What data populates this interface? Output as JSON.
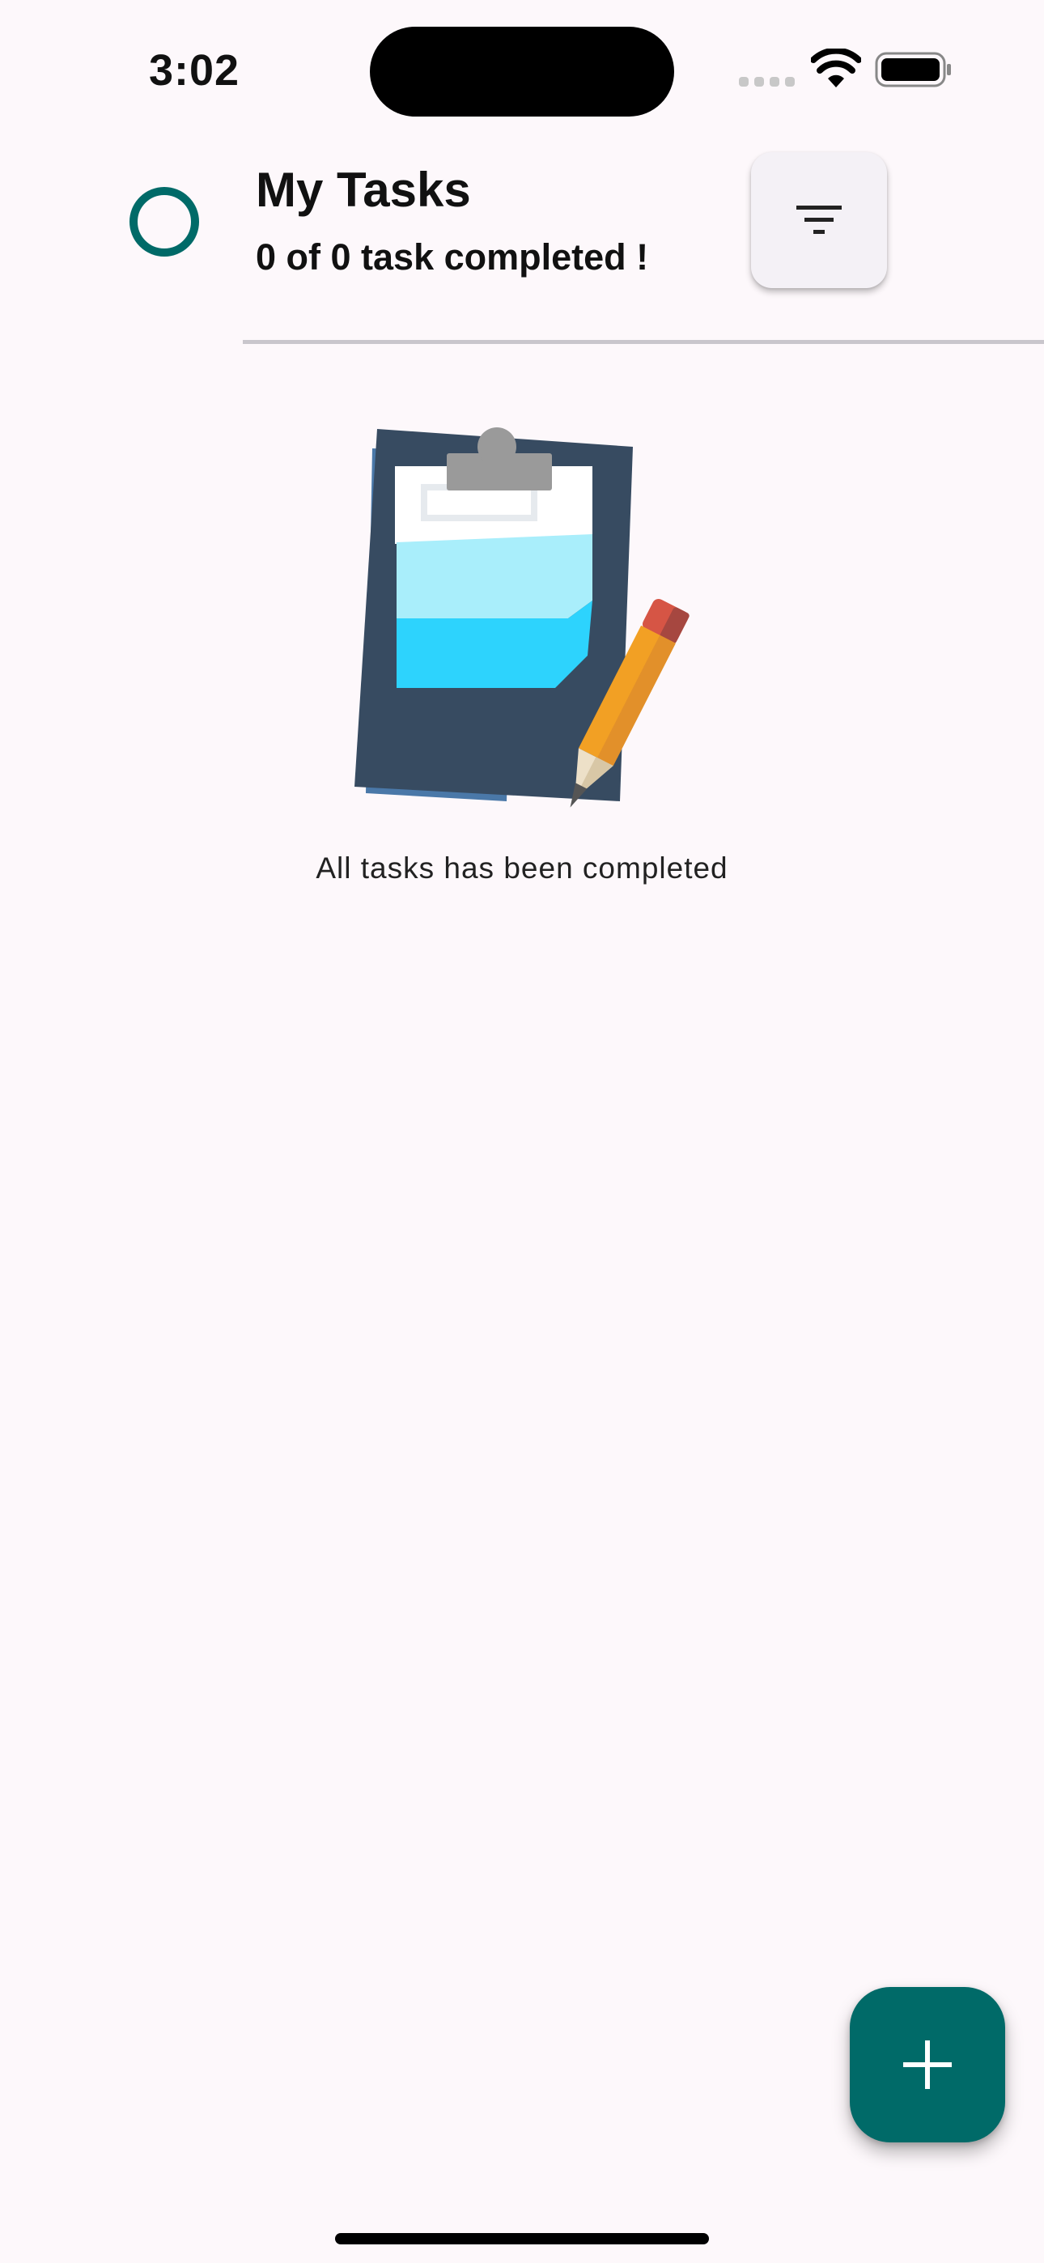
{
  "status_bar": {
    "time": "3:02"
  },
  "header": {
    "title": "My Tasks",
    "summary": "0 of 0 task completed !",
    "progress_icon": "progress-ring-icon",
    "filter_icon": "filter-icon"
  },
  "empty_state": {
    "illustration": "clipboard-pencil-illustration",
    "message": "All tasks has been completed"
  },
  "fab": {
    "icon": "plus-icon"
  },
  "colors": {
    "accent": "#006a68",
    "background": "#fdf8fb",
    "filter_button_bg": "#f4f1f6",
    "divider": "#c9c6cc"
  }
}
